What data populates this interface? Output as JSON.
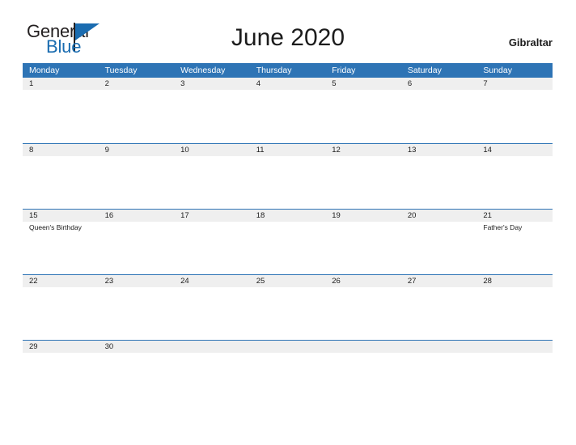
{
  "brand": {
    "name_part1": "General",
    "name_part2": "Blue",
    "triangle_icon": "triangle-icon",
    "colors": {
      "blue": "#1a6cb0",
      "dark": "#231f20"
    }
  },
  "header": {
    "title": "June 2020",
    "locale": "Gibraltar"
  },
  "calendar": {
    "colors": {
      "header_blue": "#2e74b5",
      "row_band": "#efefef",
      "text": "#1c1c1c"
    },
    "weekdays": [
      "Monday",
      "Tuesday",
      "Wednesday",
      "Thursday",
      "Friday",
      "Saturday",
      "Sunday"
    ],
    "weeks": [
      {
        "days": [
          {
            "number": "1",
            "event": ""
          },
          {
            "number": "2",
            "event": ""
          },
          {
            "number": "3",
            "event": ""
          },
          {
            "number": "4",
            "event": ""
          },
          {
            "number": "5",
            "event": ""
          },
          {
            "number": "6",
            "event": ""
          },
          {
            "number": "7",
            "event": ""
          }
        ]
      },
      {
        "days": [
          {
            "number": "8",
            "event": ""
          },
          {
            "number": "9",
            "event": ""
          },
          {
            "number": "10",
            "event": ""
          },
          {
            "number": "11",
            "event": ""
          },
          {
            "number": "12",
            "event": ""
          },
          {
            "number": "13",
            "event": ""
          },
          {
            "number": "14",
            "event": ""
          }
        ]
      },
      {
        "days": [
          {
            "number": "15",
            "event": "Queen's Birthday"
          },
          {
            "number": "16",
            "event": ""
          },
          {
            "number": "17",
            "event": ""
          },
          {
            "number": "18",
            "event": ""
          },
          {
            "number": "19",
            "event": ""
          },
          {
            "number": "20",
            "event": ""
          },
          {
            "number": "21",
            "event": "Father's Day"
          }
        ]
      },
      {
        "days": [
          {
            "number": "22",
            "event": ""
          },
          {
            "number": "23",
            "event": ""
          },
          {
            "number": "24",
            "event": ""
          },
          {
            "number": "25",
            "event": ""
          },
          {
            "number": "26",
            "event": ""
          },
          {
            "number": "27",
            "event": ""
          },
          {
            "number": "28",
            "event": ""
          }
        ]
      },
      {
        "days": [
          {
            "number": "29",
            "event": ""
          },
          {
            "number": "30",
            "event": ""
          },
          {
            "number": "",
            "event": ""
          },
          {
            "number": "",
            "event": ""
          },
          {
            "number": "",
            "event": ""
          },
          {
            "number": "",
            "event": ""
          },
          {
            "number": "",
            "event": ""
          }
        ]
      }
    ]
  }
}
